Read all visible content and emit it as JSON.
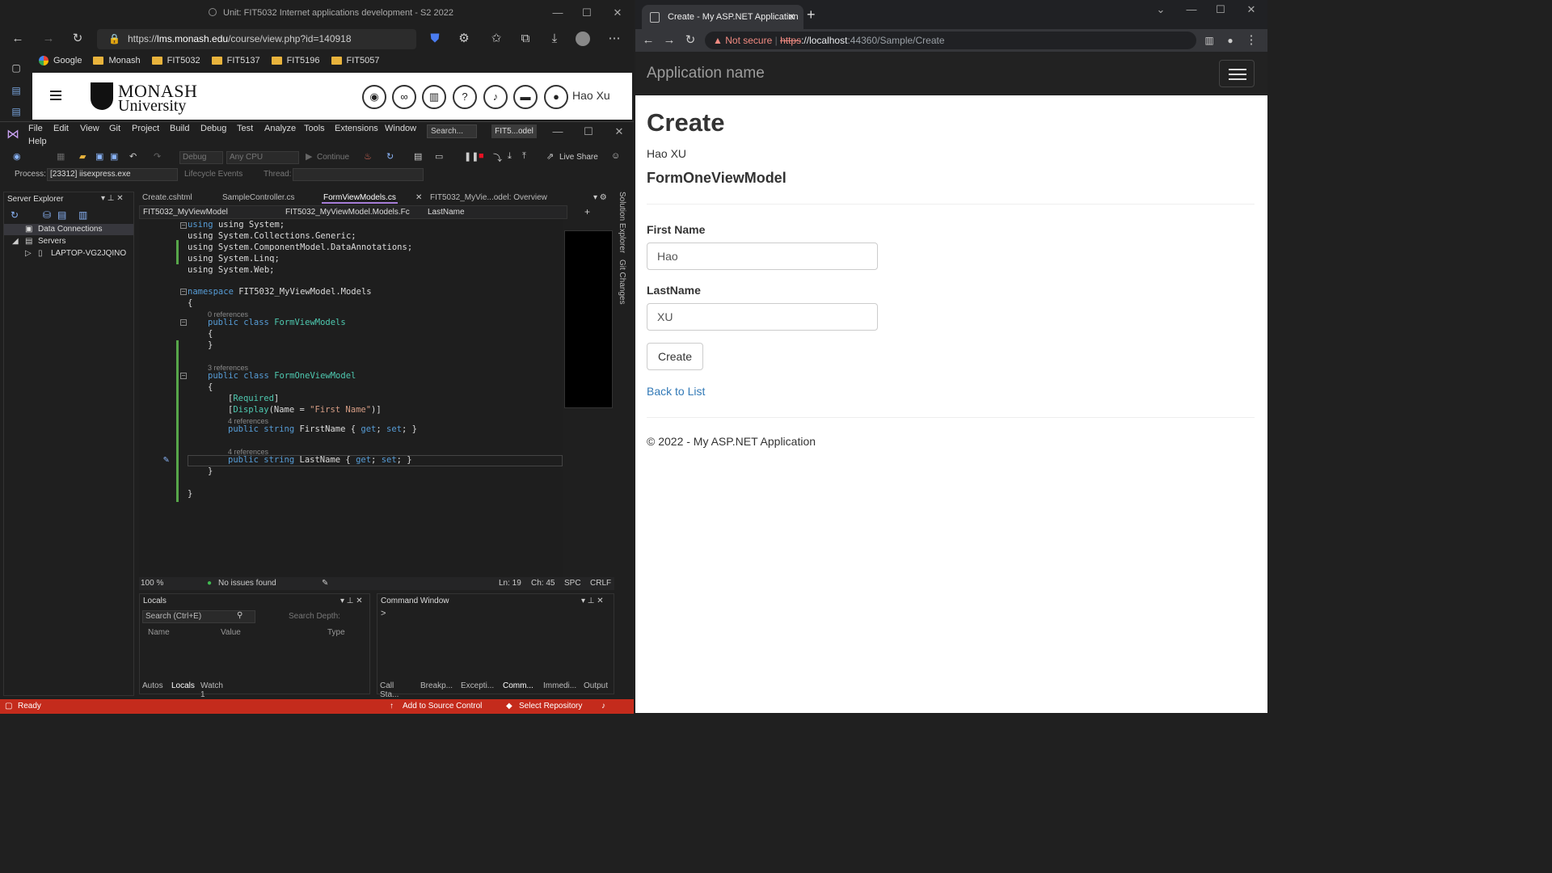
{
  "edge": {
    "title": "Unit: FIT5032 Internet applications development - S2 2022",
    "url_prefix": "https://",
    "url_host": "lms.monash.edu",
    "url_path": "/course/view.php?id=140918",
    "bookmarks": [
      "Google",
      "Monash",
      "FIT5032",
      "FIT5137",
      "FIT5196",
      "FIT5057"
    ],
    "page": {
      "logo_line1": "MONASH",
      "logo_line2": "University",
      "user_name": "Hao Xu"
    }
  },
  "vs": {
    "menu": [
      "File",
      "Edit",
      "View",
      "Git",
      "Project",
      "Build",
      "Debug",
      "Test",
      "Analyze",
      "Tools",
      "Extensions",
      "Window",
      "Help"
    ],
    "search": "Search...",
    "solution_name": "FIT5...odel",
    "toolbar": {
      "config": "Debug",
      "platform": "Any CPU",
      "continue": "Continue",
      "live_share": "Live Share"
    },
    "process_label": "Process:",
    "process_value": "[23312] iisexpress.exe",
    "lifecycle": "Lifecycle Events",
    "thread_label": "Thread:",
    "server_explorer": {
      "title": "Server Explorer",
      "items": [
        "Data Connections",
        "Servers",
        "LAPTOP-VG2JQINO"
      ]
    },
    "tabs": [
      "Create.cshtml",
      "SampleController.cs",
      "FormViewModels.cs",
      "FIT5032_MyVie...odel: Overview"
    ],
    "nav": {
      "project": "FIT5032_MyViewModel",
      "type": "FIT5032_MyViewModel.Models.Fc",
      "member": "LastName"
    },
    "code": {
      "l1": "using System;",
      "l2": "using System.Collections.Generic;",
      "l3": "using System.ComponentModel.DataAnnotations;",
      "l4": "using System.Linq;",
      "l5": "using System.Web;",
      "ns": "FIT5032_MyViewModel.Models",
      "ref0": "0 references",
      "class1": "FormViewModels",
      "ref3": "3 references",
      "class2": "FormOneViewModel",
      "required": "Required",
      "display_name": "\"First Name\"",
      "ref4a": "4 references",
      "prop1": "FirstName",
      "ref4b": "4 references",
      "prop2": "LastName"
    },
    "editor_status": {
      "zoom": "100 %",
      "issues": "No issues found",
      "ln": "Ln: 19",
      "ch": "Ch: 45",
      "spc": "SPC",
      "crlf": "CRLF"
    },
    "locals": {
      "title": "Locals",
      "search": "Search (Ctrl+E)",
      "search_depth": "Search Depth:",
      "col_name": "Name",
      "col_value": "Value",
      "col_type": "Type"
    },
    "command_window": {
      "title": "Command Window",
      "prompt": ">"
    },
    "bottom_tabs_left": [
      "Autos",
      "Locals",
      "Watch 1"
    ],
    "bottom_tabs_right": [
      "Call Sta...",
      "Breakp...",
      "Excepti...",
      "Comm...",
      "Immedi...",
      "Output"
    ],
    "statusbar": {
      "ready": "Ready",
      "source_control": "Add to Source Control",
      "repo": "Select Repository"
    },
    "side_strip": [
      "Solution Explorer",
      "Git Changes"
    ]
  },
  "chrome": {
    "tab_title": "Create - My ASP.NET Application",
    "not_secure": "Not secure",
    "url_scheme": "https",
    "url_host": "://localhost",
    "url_rest": ":44360/Sample/Create",
    "site": {
      "brand": "Application name",
      "heading": "Create",
      "name_line": "Hao XU",
      "model_title": "FormOneViewModel",
      "first_name_label": "First Name",
      "first_name_value": "Hao",
      "last_name_label": "LastName",
      "last_name_value": "XU",
      "create_button": "Create",
      "back_link": "Back to List",
      "footer": "© 2022 - My ASP.NET Application"
    }
  },
  "colors": {
    "vs_status": "#c42b1c",
    "keyword": "#569cd6",
    "type": "#4ec9b0",
    "string": "#d69d85",
    "link": "#337ab7"
  }
}
